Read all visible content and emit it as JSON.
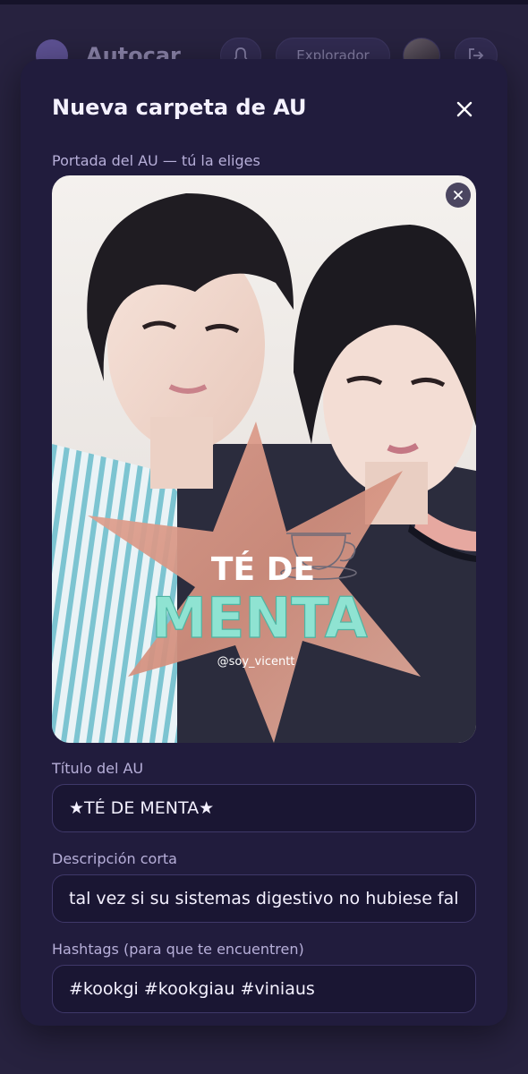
{
  "app": {
    "name": "Autocar",
    "explore_label": "Explorador"
  },
  "modal": {
    "title": "Nueva carpeta de AU",
    "cover_label": "Portada del AU — tú la eliges",
    "cover": {
      "star_text_line1": "TÉ DE",
      "star_text_line2": "MENTA",
      "credit": "@soy_vicentt"
    },
    "title_label": "Título del AU",
    "title_value": "★TÉ DE MENTA★",
    "description_label": "Descripción corta",
    "description_value": "tal vez si su sistemas digestivo no hubiese fallc",
    "hashtags_label": "Hashtags (para que te encuentren)",
    "hashtags_value": "#kookgi #kookgiau #viniaus"
  },
  "icons": {
    "bell": "bell-icon",
    "logout": "logout-icon",
    "close": "close-icon",
    "remove_cover": "close-icon"
  },
  "colors": {
    "background": "#27223f",
    "modal": "#211c3d",
    "input_bg": "#1a1633",
    "input_border": "#3f3869",
    "accent": "#8a78d8",
    "mint_text": "#8fe3d2",
    "star": "#d79a8a"
  }
}
